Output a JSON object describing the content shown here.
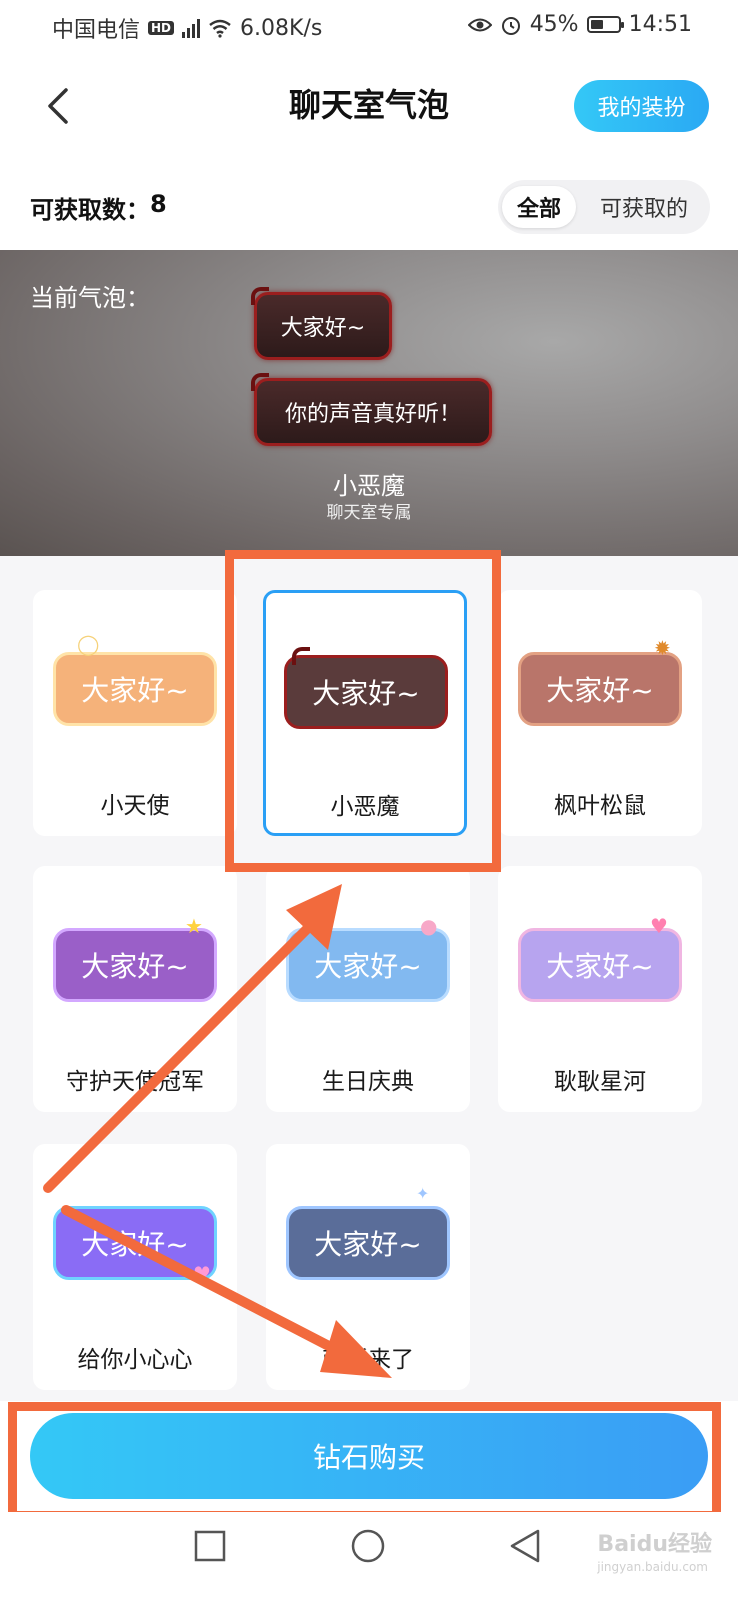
{
  "status_bar": {
    "carrier": "中国电信",
    "hd": "HD",
    "net_speed": "6.08K/s",
    "battery_pct": "45%",
    "battery_level": 0.45,
    "time": "14:51"
  },
  "header": {
    "title": "聊天室气泡",
    "my_outfit_label": "我的装扮"
  },
  "summary": {
    "count_label": "可获取数：",
    "count_value": "8"
  },
  "filter": {
    "all_label": "全部",
    "available_label": "可获取的"
  },
  "preview": {
    "label": "当前气泡：",
    "bubble_1": "大家好~",
    "bubble_2": "你的声音真好听！",
    "name": "小恶魔",
    "subtitle": "聊天室专属"
  },
  "bubbles": [
    {
      "name": "小天使",
      "text": "大家好~",
      "color": "#f5b27a"
    },
    {
      "name": "小恶魔",
      "text": "大家好~",
      "color": "#5a3b3b",
      "selected": true
    },
    {
      "name": "枫叶松鼠",
      "text": "大家好~",
      "color": "#b9756a"
    },
    {
      "name": "守护天使冠军",
      "text": "大家好~",
      "color": "#9a5fc8"
    },
    {
      "name": "生日庆典",
      "text": "大家好~",
      "color": "#82b9f0"
    },
    {
      "name": "耿耿星河",
      "text": "大家好~",
      "color": "#b7a4ef"
    },
    {
      "name": "给你小心心",
      "text": "大家好~",
      "color": "#8a6cf5"
    },
    {
      "name": "萌新来了",
      "text": "大家好~",
      "color": "#5a6d99"
    }
  ],
  "buy_button": {
    "label": "钻石购买"
  },
  "watermark": {
    "brand": "Baidu经验",
    "url": "jingyan.baidu.com"
  },
  "icons": [
    "back-arrow-icon",
    "eye-icon",
    "alarm-icon",
    "wifi-icon",
    "signal-icon",
    "battery-icon"
  ]
}
